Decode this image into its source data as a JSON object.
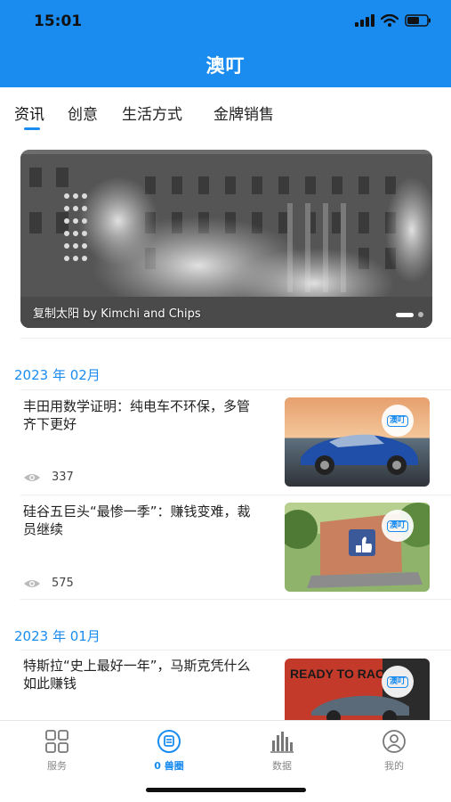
{
  "status_bar": {
    "time": "15:01"
  },
  "app": {
    "title": "澳叮"
  },
  "tabs": [
    {
      "label": "资讯",
      "active": true
    },
    {
      "label": "创意",
      "active": false
    },
    {
      "label": "生活方式",
      "active": false
    },
    {
      "label": "金牌销售",
      "active": false
    }
  ],
  "banner": {
    "caption": "复制太阳 by Kimchi and Chips"
  },
  "sections": [
    {
      "month": "2023 年 02月",
      "articles": [
        {
          "title": "丰田用数学证明：纯电车不环保，多管齐下更好",
          "views": "337",
          "badge": "澳叮"
        },
        {
          "title": "硅谷五巨头“最惨一季”：赚钱变难，裁员继续",
          "views": "575",
          "badge": "澳叮"
        }
      ]
    },
    {
      "month": "2023 年 01月",
      "articles": [
        {
          "title": "特斯拉“史上最好一年”，马斯克凭什么如此赚钱",
          "badge": "澳叮"
        }
      ]
    }
  ],
  "thumb_text": {
    "car_ad": "READY TO RACE"
  },
  "bottom_nav": [
    {
      "label": "服务",
      "icon": "grid-icon",
      "active": false
    },
    {
      "label": "0 兽圈",
      "icon": "circle-badge-icon",
      "active": true
    },
    {
      "label": "数据",
      "icon": "bar-chart-icon",
      "active": false
    },
    {
      "label": "我的",
      "icon": "user-icon",
      "active": false
    }
  ],
  "colors": {
    "accent": "#1a8cf0",
    "header_bg": "#1a8cf0"
  }
}
